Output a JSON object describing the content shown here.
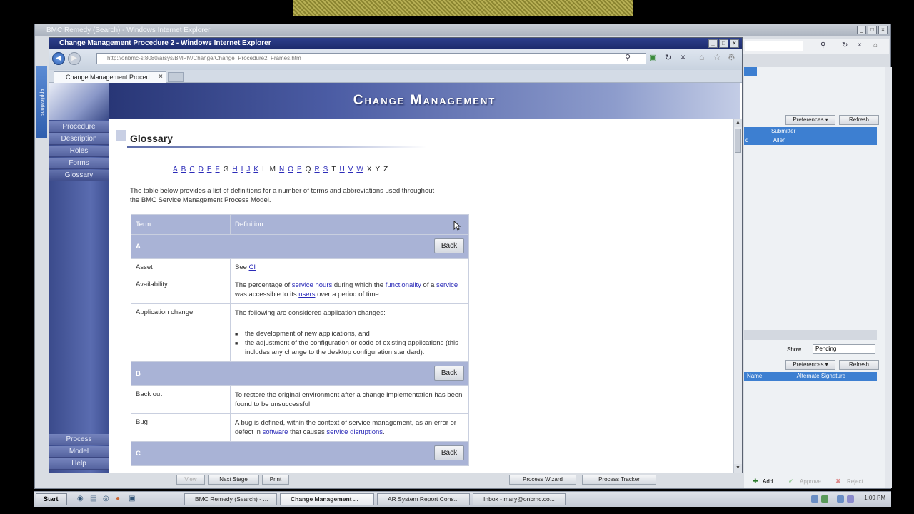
{
  "back_window": {
    "title": "BMC Remedy (Search) - Windows Internet Explorer",
    "right_panel": {
      "preferences_label": "Preferences ▾",
      "refresh_label": "Refresh",
      "row1": "Submitter",
      "row2_a": "d",
      "row2_b": "Allen",
      "show_label": "Show",
      "show_value": "Pending",
      "preferences2_label": "Preferences ▾",
      "refresh2_label": "Refresh",
      "col_name": "Name",
      "col_alt": "Alternate Signature",
      "add_label": "Add",
      "approve_label": "Approve",
      "reject_label": "Reject"
    },
    "side_strip": "Applications",
    "bottom_buttons": [
      "View",
      "Next Stage",
      "Print",
      "Process Wizard",
      "Process Tracker"
    ]
  },
  "front_window": {
    "title": "Change Management Procedure 2 - Windows Internet Explorer",
    "url": "http://onbmc-s:8080/arsys/BMPM/Change/Change_Procedure2_Frames.htm",
    "tab_label": "Change Management Proced...",
    "banner_title": "Change Management",
    "nav_items": [
      "Procedure",
      "Description",
      "Roles",
      "Forms",
      "Glossary"
    ],
    "nav_bottom": [
      "Process",
      "Model",
      "Help"
    ]
  },
  "content": {
    "heading": "Glossary",
    "alphabet": [
      {
        "l": "A",
        "link": true
      },
      {
        "l": "B",
        "link": true
      },
      {
        "l": "C",
        "link": true
      },
      {
        "l": "D",
        "link": true
      },
      {
        "l": "E",
        "link": true
      },
      {
        "l": "F",
        "link": true
      },
      {
        "l": "G",
        "link": false
      },
      {
        "l": "H",
        "link": true
      },
      {
        "l": "I",
        "link": true
      },
      {
        "l": "J",
        "link": true
      },
      {
        "l": "K",
        "link": true
      },
      {
        "l": "L",
        "link": false
      },
      {
        "l": "M",
        "link": false
      },
      {
        "l": "N",
        "link": true
      },
      {
        "l": "O",
        "link": true
      },
      {
        "l": "P",
        "link": true
      },
      {
        "l": "Q",
        "link": false
      },
      {
        "l": "R",
        "link": true
      },
      {
        "l": "S",
        "link": true
      },
      {
        "l": "T",
        "link": false
      },
      {
        "l": "U",
        "link": true
      },
      {
        "l": "V",
        "link": true
      },
      {
        "l": "W",
        "link": true
      },
      {
        "l": "X",
        "link": false
      },
      {
        "l": "Y",
        "link": false
      },
      {
        "l": "Z",
        "link": false
      }
    ],
    "intro": "The table below provides a list of definitions for a number of terms and abbreviations used throughout the BMC Service Management Process Model.",
    "col_term": "Term",
    "col_definition": "Definition",
    "back_label": "Back",
    "letter_a": "A",
    "letter_b": "B",
    "letter_c": "C",
    "asset_term": "Asset",
    "asset_def_pre": "See ",
    "asset_def_link": "CI",
    "avail_term": "Availability",
    "avail_1": "The percentage of ",
    "avail_link1": "service hours",
    "avail_2": " during which the ",
    "avail_link2": "functionality",
    "avail_3": " of a ",
    "avail_link3": "service",
    "avail_4": " was accessible to its ",
    "avail_link4": "users",
    "avail_5": " over a period of time.",
    "appchange_term": "Application change",
    "appchange_def": "The following are considered application changes:",
    "appchange_b1": "the development of new applications, and",
    "appchange_b2": "the adjustment of the configuration or code of existing applications (this includes any change to the desktop configuration standard).",
    "backout_term": "Back out",
    "backout_def": "To restore the original environment after a change implementation has been found to be unsuccessful.",
    "bug_term": "Bug",
    "bug_1": "A bug is defined, within the context of service management, as an error or defect in ",
    "bug_link1": "software",
    "bug_2": " that causes ",
    "bug_link2": "service disruptions",
    "bug_3": "."
  },
  "taskbar": {
    "start": "Start",
    "tasks": [
      "BMC Remedy (Search) - ...",
      "Change Management ...",
      "AR System Report Cons...",
      "Inbox - mary@onbmc.co..."
    ],
    "clock": "1:09 PM"
  }
}
